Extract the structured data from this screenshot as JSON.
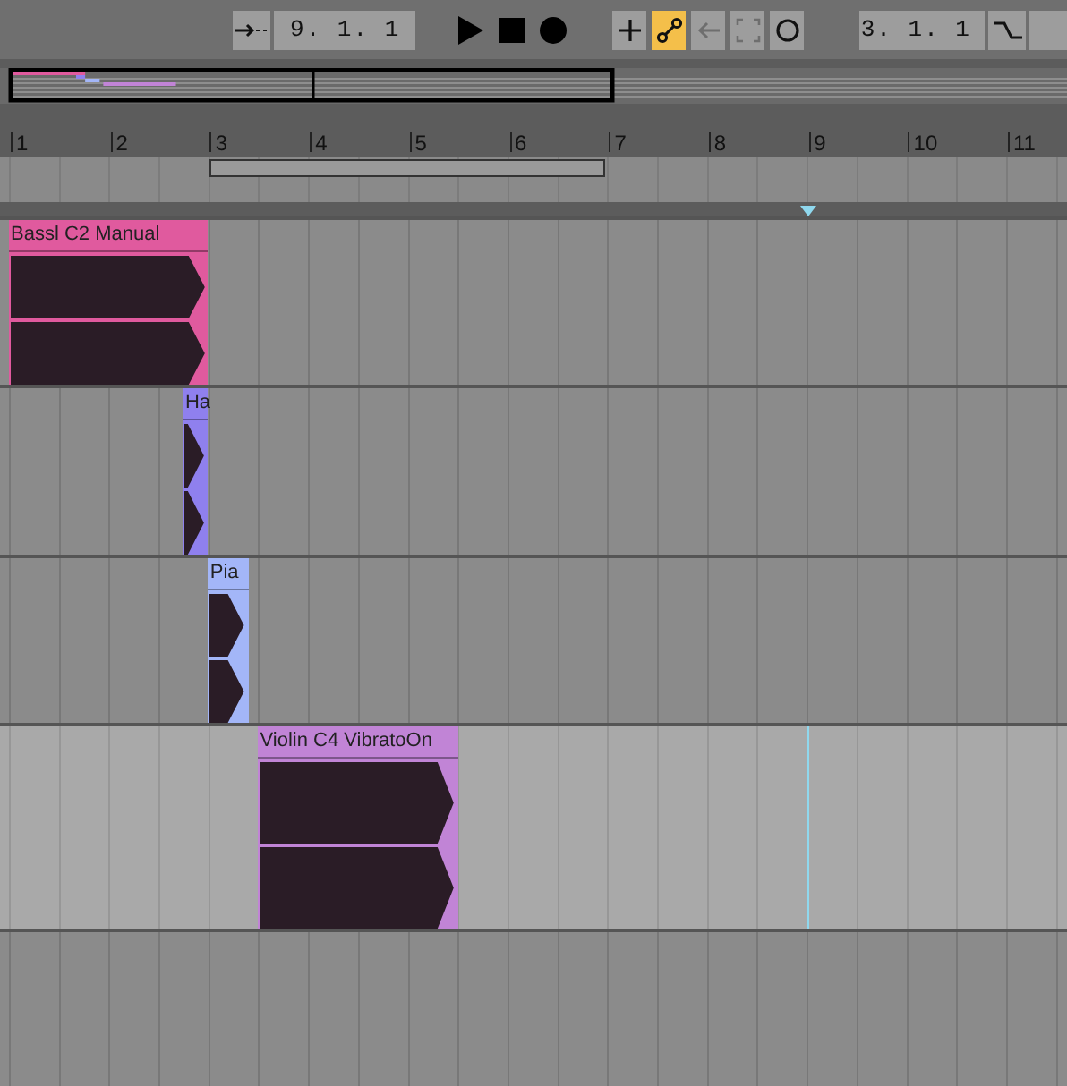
{
  "transport": {
    "punch_button": {
      "on": false
    },
    "position": "9. 1. 1",
    "play": {
      "on": false
    },
    "stop": {
      "on": false
    },
    "record": {
      "on": false
    },
    "tools": [
      {
        "kind": "add",
        "on": false,
        "disabled": false
      },
      {
        "kind": "link",
        "on": true,
        "disabled": false
      },
      {
        "kind": "back",
        "on": false,
        "disabled": true
      },
      {
        "kind": "frame",
        "on": false,
        "disabled": true
      },
      {
        "kind": "circle",
        "on": false,
        "disabled": false
      }
    ],
    "loop_length": "3. 1. 1",
    "curve_button": {
      "on": false
    }
  },
  "ruler": {
    "bars": [
      "1",
      "2",
      "3",
      "4",
      "5",
      "6",
      "7",
      "8",
      "9",
      "10",
      "11"
    ]
  },
  "tracks": [
    {
      "selected": false,
      "clip": {
        "name": "Bassl C2 Manual",
        "color": "#e05a9e"
      }
    },
    {
      "selected": false,
      "clip": {
        "name": "Ha",
        "color": "#8f80ee"
      }
    },
    {
      "selected": false,
      "clip": {
        "name": "Pia",
        "color": "#a3b6f8"
      }
    },
    {
      "selected": true,
      "clip": {
        "name": "Violin C4 VibratoOn",
        "color": "#c184d6"
      }
    }
  ]
}
